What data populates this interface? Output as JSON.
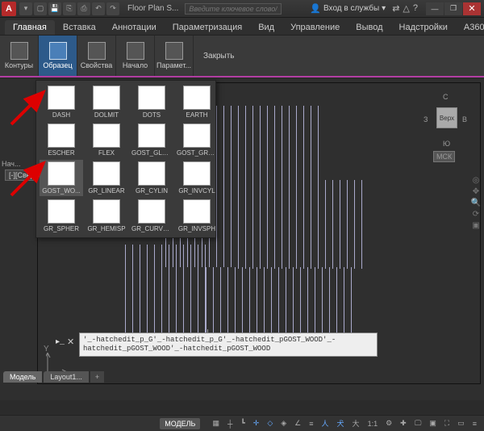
{
  "titlebar": {
    "app_letter": "A",
    "doc_title": "Floor Plan S...",
    "search_placeholder": "Введите ключевое слово/фразу",
    "login_label": "Вход в службы"
  },
  "tabs": {
    "items": [
      "Главная",
      "Вставка",
      "Аннотации",
      "Параметризация",
      "Вид",
      "Управление",
      "Вывод",
      "Надстройки",
      "A360"
    ],
    "active_index": 0
  },
  "ribbon": {
    "buttons": [
      "Контуры",
      "Образец",
      "Свойства",
      "Начало",
      "Парамет..."
    ],
    "active_index": 1,
    "close": "Закрыть"
  },
  "sidebar": {
    "label": "Нач...",
    "dropdown": "[-][Сверху"
  },
  "palette": {
    "items": [
      {
        "name": "DASH",
        "cls": "th-dash"
      },
      {
        "name": "DOLMIT",
        "cls": "th-dolmit"
      },
      {
        "name": "DOTS",
        "cls": "th-dots"
      },
      {
        "name": "EARTH",
        "cls": "th-earth"
      },
      {
        "name": "ESCHER",
        "cls": "th-escher"
      },
      {
        "name": "FLEX",
        "cls": "th-flex"
      },
      {
        "name": "GOST_GLASS",
        "cls": "th-gglass"
      },
      {
        "name": "GOST_GRO...",
        "cls": "th-ggro"
      },
      {
        "name": "GOST_WO...",
        "cls": "th-gwood"
      },
      {
        "name": "GR_LINEAR",
        "cls": "th-grlin"
      },
      {
        "name": "GR_CYLIN",
        "cls": "th-grcyl"
      },
      {
        "name": "GR_INVCYL",
        "cls": "th-grinv"
      },
      {
        "name": "GR_SPHER",
        "cls": "th-grsph"
      },
      {
        "name": "GR_HEMISP",
        "cls": "th-grhem"
      },
      {
        "name": "GR_CURVED",
        "cls": "th-grcur"
      },
      {
        "name": "GR_INVSPH",
        "cls": "th-grisp"
      }
    ],
    "selected_index": 8
  },
  "viewcube": {
    "north": "С",
    "south": "Ю",
    "west": "З",
    "east": "В",
    "top": "Верх",
    "wcs": "МСК"
  },
  "ucs": {
    "x": "X",
    "y": "Y"
  },
  "cmdline": {
    "text": "'_-hatchedit_p_G'_-hatchedit_p_G'_-hatchedit_pGOST_WOOD'_-hatchedit_pGOST_WOOD'_-hatchedit_pGOST_WOOD"
  },
  "layouttabs": {
    "items": [
      "Модель",
      "Layout1..."
    ],
    "active_index": 0,
    "plus": "+"
  },
  "statusbar": {
    "model": "МОДЕЛЬ",
    "scale": "1:1"
  }
}
